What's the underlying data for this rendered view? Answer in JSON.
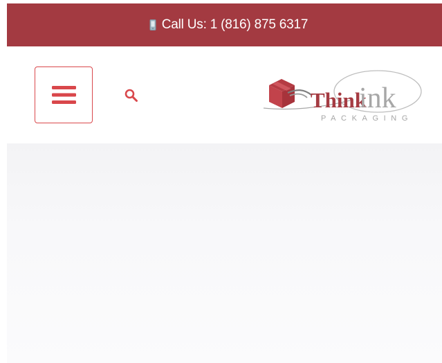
{
  "topbar": {
    "call_text": "Call Us: 1 (816) 875 6317"
  },
  "header": {
    "menu_button": "hamburger-menu",
    "search_button": "search",
    "logo": {
      "brand_main": "Think",
      "brand_ink": "ink",
      "tagline": "PACKAGING"
    }
  },
  "colors": {
    "top_bar": "#a33a41",
    "accent": "#d9474b",
    "logo_red": "#a53b42",
    "logo_gray": "#9a9a9a"
  },
  "icons": {
    "phone": "phone-icon",
    "menu": "hamburger-icon",
    "search": "search-icon",
    "logo_mark": "box-logo-icon"
  }
}
